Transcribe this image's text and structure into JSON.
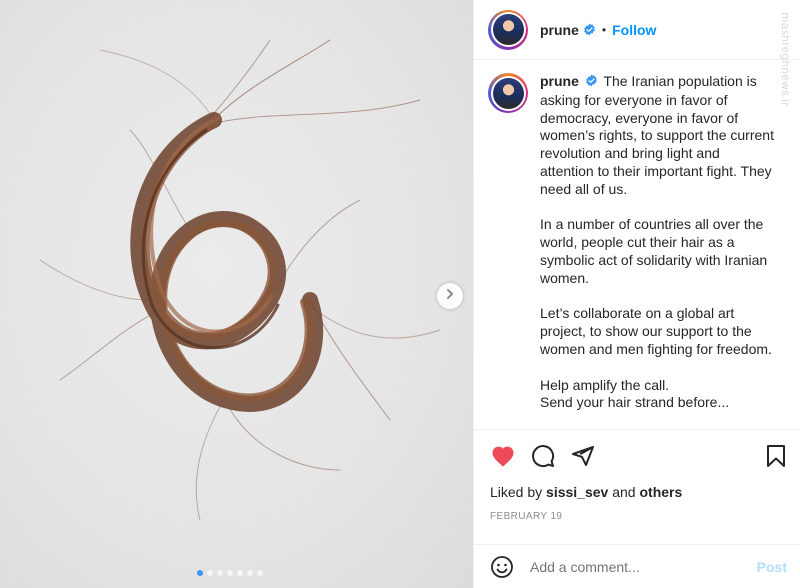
{
  "post": {
    "image_description_alt": "",
    "carousel": {
      "total": 7,
      "active_index": 0
    }
  },
  "header": {
    "username": "prune",
    "separator": "•",
    "follow_label": "Follow"
  },
  "watermark": {
    "text": "mashreghnews.ir"
  },
  "caption": {
    "username": "prune",
    "paragraphs": [
      "The Iranian population is asking for everyone in favor of democracy, everyone in favor of women’s rights, to support the current revolution and bring light and attention to their important fight. They need all of us.",
      "In a number of countries all over the world, people cut their hair as a symbolic act of solidarity with Iranian women.",
      "Let’s collaborate on a global art project, to show our support to the women and men fighting for freedom.",
      "Help amplify the call.\nSend your hair strand before..."
    ]
  },
  "actions": {
    "liked_prefix": "Liked by",
    "liked_user": "sissi_sev",
    "liked_and": "and",
    "liked_others": "others",
    "date": "FEBRUARY 19"
  },
  "comment": {
    "placeholder": "Add a comment...",
    "post_label": "Post"
  },
  "colors": {
    "like_red": "#ed4956",
    "link_blue": "#0095f6",
    "post_disabled": "#b2dffc",
    "verified_blue": "#3897f0"
  }
}
